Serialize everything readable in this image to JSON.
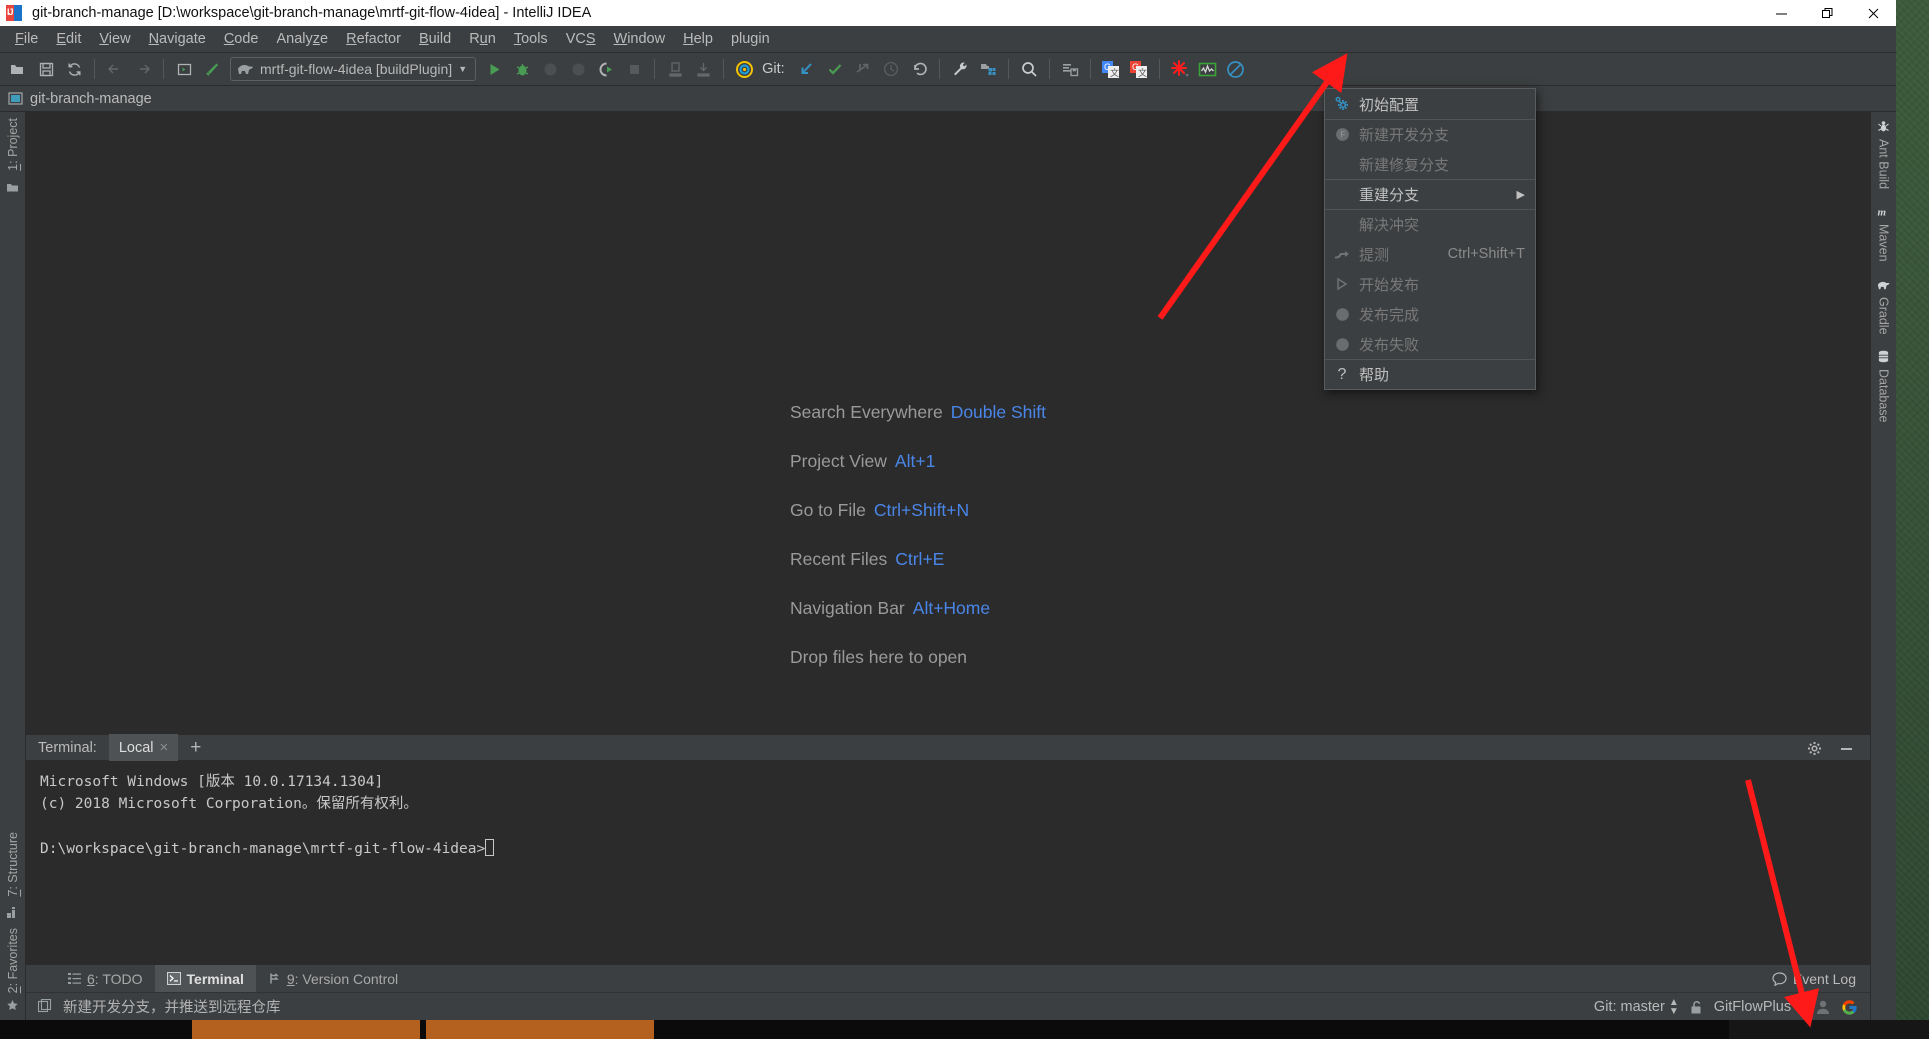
{
  "window": {
    "title": "git-branch-manage [D:\\workspace\\git-branch-manage\\mrtf-git-flow-4idea] - IntelliJ IDEA",
    "minimize": "—",
    "maximize": "❐",
    "close": "✕"
  },
  "menubar": {
    "items": [
      {
        "pre": "F",
        "label": "ile"
      },
      {
        "pre": "E",
        "label": "dit"
      },
      {
        "pre": "V",
        "label": "iew"
      },
      {
        "pre": "N",
        "label": "avigate"
      },
      {
        "pre": "C",
        "label": "ode"
      },
      {
        "pre": "",
        "label": "Analyze",
        "mid": "z"
      },
      {
        "pre": "R",
        "label": "efactor"
      },
      {
        "pre": "B",
        "label": "uild"
      },
      {
        "pre": "R",
        "label": "un"
      },
      {
        "pre": "T",
        "label": "ools"
      },
      {
        "pre": "",
        "label": "VCS"
      },
      {
        "pre": "W",
        "label": "indow"
      },
      {
        "pre": "H",
        "label": "elp"
      },
      {
        "pre": "",
        "label": "plugin"
      }
    ]
  },
  "toolbar": {
    "open_label": "open-folder-icon",
    "save_label": "save-icon",
    "sync_label": "sync-icon",
    "back_label": "back-arrow-icon",
    "forward_label": "forward-arrow-icon",
    "run_config_name": "mrtf-git-flow-4idea [buildPlugin]",
    "run_config_caret": "▼",
    "git_label": "Git:"
  },
  "navbar": {
    "project_name": "git-branch-manage"
  },
  "left_strip": {
    "project_prefix": "1",
    "project_label": ": Project",
    "structure_prefix": "7",
    "structure_label": ": Structure",
    "favorites_prefix": "2",
    "favorites_label": ": Favorites"
  },
  "right_strip": {
    "items": [
      {
        "label": "Ant Build",
        "icon": "ant-icon"
      },
      {
        "label": "Maven",
        "icon": "maven-icon"
      },
      {
        "label": "Gradle",
        "icon": "gradle-elephant-icon"
      },
      {
        "label": "Database",
        "icon": "database-icon"
      }
    ]
  },
  "editor_tips": [
    {
      "label": "Search Everywhere",
      "key": "Double Shift"
    },
    {
      "label": "Project View",
      "key": "Alt+1"
    },
    {
      "label": "Go to File",
      "key": "Ctrl+Shift+N"
    },
    {
      "label": "Recent Files",
      "key": "Ctrl+E"
    },
    {
      "label": "Navigation Bar",
      "key": "Alt+Home"
    },
    {
      "label": "Drop files here to open",
      "key": ""
    }
  ],
  "popup_menu": {
    "items": [
      {
        "label": "初始配置",
        "icon": "gear-config-icon",
        "enabled": true,
        "accel": "",
        "submenu": false,
        "separator_above": false
      },
      {
        "label": "新建开发分支",
        "icon": "feature-circle-icon",
        "enabled": false,
        "accel": "",
        "submenu": false,
        "separator_above": true
      },
      {
        "label": "新建修复分支",
        "icon": "",
        "enabled": false,
        "accel": "",
        "submenu": false,
        "separator_above": false
      },
      {
        "label": "重建分支",
        "icon": "",
        "enabled": true,
        "accel": "",
        "submenu": true,
        "separator_above": true
      },
      {
        "label": "解决冲突",
        "icon": "",
        "enabled": false,
        "accel": "",
        "submenu": false,
        "separator_above": true
      },
      {
        "label": "提测",
        "icon": "merge-arrow-icon",
        "enabled": false,
        "accel": "Ctrl+Shift+T",
        "submenu": false,
        "separator_above": false
      },
      {
        "label": "开始发布",
        "icon": "play-triangle-icon",
        "enabled": false,
        "accel": "",
        "submenu": false,
        "separator_above": false
      },
      {
        "label": "发布完成",
        "icon": "circle-icon",
        "enabled": false,
        "accel": "",
        "submenu": false,
        "separator_above": false
      },
      {
        "label": "发布失败",
        "icon": "circle-icon",
        "enabled": false,
        "accel": "",
        "submenu": false,
        "separator_above": false
      },
      {
        "label": "帮助",
        "icon": "question-mark-icon",
        "enabled": true,
        "accel": "",
        "submenu": false,
        "separator_above": true
      }
    ]
  },
  "terminal": {
    "title": "Terminal:",
    "tab_label": "Local",
    "tab_close": "×",
    "add_tab": "+",
    "lines": [
      "Microsoft Windows [版本 10.0.17134.1304]",
      "(c) 2018 Microsoft Corporation。保留所有权利。",
      "",
      "D:\\workspace\\git-branch-manage\\mrtf-git-flow-4idea>"
    ]
  },
  "bottom_tabs": [
    {
      "prefix": "6",
      "label": ": TODO",
      "icon": "todo-list-icon",
      "active": false
    },
    {
      "prefix": "",
      "label": "Terminal",
      "icon": "terminal-icon",
      "active": true
    },
    {
      "prefix": "9",
      "label": ": Version Control",
      "icon": "branch-icon",
      "active": false
    }
  ],
  "event_log": {
    "label": "Event Log",
    "icon": "balloon-icon"
  },
  "statusbar": {
    "message": "新建开发分支，并推送到远程仓库",
    "message_icon": "copy-icon",
    "git_branch": "Git: master",
    "lock_icon": "unlocked-icon",
    "plugin": "GitFlowPlus",
    "avatar_icon": "user-avatar-icon",
    "google_icon": "google-g-icon"
  },
  "colors": {
    "panel": "#3c3f41",
    "editor_bg": "#2b2b2b",
    "accent_blue": "#4a86e8",
    "arrow_red": "#ff1a1a",
    "green_run": "#499c54",
    "title_bg": "#ffffff"
  }
}
